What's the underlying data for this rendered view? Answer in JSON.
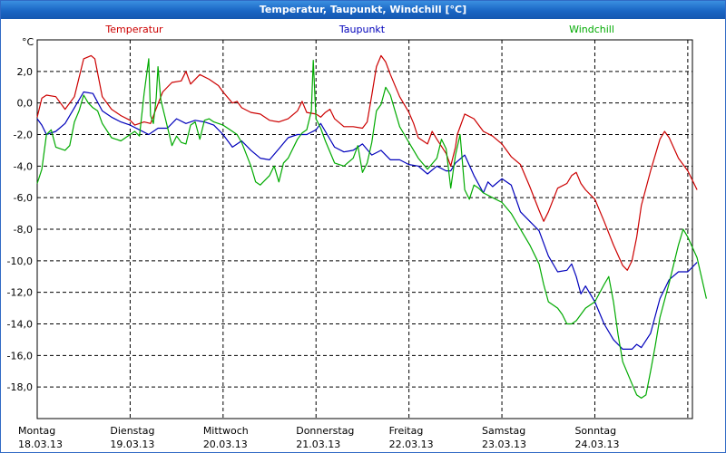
{
  "window": {
    "title": "Temperatur, Taupunkt, Windchill [°C]"
  },
  "chart_data": {
    "type": "line",
    "title": "Temperatur, Taupunkt, Windchill [°C]",
    "ylabel": "°C",
    "ylim": [
      -20,
      4
    ],
    "xlim": [
      0,
      7
    ],
    "yticks": [
      2,
      0,
      -2,
      -4,
      -6,
      -8,
      -10,
      -12,
      -14,
      -16,
      -18
    ],
    "ytick_labels": [
      "2,0",
      "0,0",
      "-2,0",
      "-4,0",
      "-6,0",
      "-8,0",
      "-10,0",
      "-12,0",
      "-14,0",
      "-16,0",
      "-18,0"
    ],
    "x_tick_labels": [
      {
        "day": "Montag",
        "date": "18.03.13"
      },
      {
        "day": "Dienstag",
        "date": "19.03.13"
      },
      {
        "day": "Mittwoch",
        "date": "20.03.13"
      },
      {
        "day": "Donnerstag",
        "date": "21.03.13"
      },
      {
        "day": "Freitag",
        "date": "22.03.13"
      },
      {
        "day": "Samstag",
        "date": "23.03.13"
      },
      {
        "day": "Sonntag",
        "date": "24.03.13"
      }
    ],
    "grid": true,
    "legend_position": "top",
    "series": [
      {
        "name": "Temperatur",
        "color": "#cc0000",
        "points": [
          [
            0,
            -0.9
          ],
          [
            0.05,
            0.3
          ],
          [
            0.1,
            0.5
          ],
          [
            0.2,
            0.4
          ],
          [
            0.3,
            -0.4
          ],
          [
            0.4,
            0.4
          ],
          [
            0.5,
            2.8
          ],
          [
            0.58,
            3.0
          ],
          [
            0.62,
            2.8
          ],
          [
            0.7,
            0.4
          ],
          [
            0.8,
            -0.4
          ],
          [
            0.9,
            -0.8
          ],
          [
            1.0,
            -1.1
          ],
          [
            1.05,
            -1.4
          ],
          [
            1.15,
            -1.2
          ],
          [
            1.22,
            -1.3
          ],
          [
            1.27,
            -0.5
          ],
          [
            1.35,
            0.7
          ],
          [
            1.45,
            1.3
          ],
          [
            1.55,
            1.4
          ],
          [
            1.6,
            2.0
          ],
          [
            1.65,
            1.2
          ],
          [
            1.75,
            1.8
          ],
          [
            1.85,
            1.5
          ],
          [
            1.95,
            1.1
          ],
          [
            2.0,
            0.7
          ],
          [
            2.1,
            0.0
          ],
          [
            2.15,
            0.1
          ],
          [
            2.2,
            -0.3
          ],
          [
            2.3,
            -0.6
          ],
          [
            2.4,
            -0.7
          ],
          [
            2.5,
            -1.1
          ],
          [
            2.6,
            -1.2
          ],
          [
            2.7,
            -1.0
          ],
          [
            2.8,
            -0.5
          ],
          [
            2.85,
            0.1
          ],
          [
            2.9,
            -0.6
          ],
          [
            3.0,
            -0.7
          ],
          [
            3.05,
            -0.9
          ],
          [
            3.1,
            -0.6
          ],
          [
            3.15,
            -0.4
          ],
          [
            3.2,
            -1.0
          ],
          [
            3.3,
            -1.5
          ],
          [
            3.4,
            -1.5
          ],
          [
            3.5,
            -1.6
          ],
          [
            3.55,
            -1.2
          ],
          [
            3.6,
            0.5
          ],
          [
            3.65,
            2.3
          ],
          [
            3.7,
            3.0
          ],
          [
            3.75,
            2.6
          ],
          [
            3.8,
            1.8
          ],
          [
            3.9,
            0.4
          ],
          [
            4.0,
            -0.6
          ],
          [
            4.05,
            -1.3
          ],
          [
            4.1,
            -2.2
          ],
          [
            4.2,
            -2.6
          ],
          [
            4.25,
            -1.8
          ],
          [
            4.3,
            -2.3
          ],
          [
            4.4,
            -3.2
          ],
          [
            4.45,
            -4.0
          ],
          [
            4.5,
            -2.8
          ],
          [
            4.52,
            -2.0
          ],
          [
            4.6,
            -0.7
          ],
          [
            4.7,
            -1.0
          ],
          [
            4.8,
            -1.8
          ],
          [
            4.9,
            -2.1
          ],
          [
            5.0,
            -2.6
          ],
          [
            5.1,
            -3.4
          ],
          [
            5.2,
            -3.9
          ],
          [
            5.3,
            -5.3
          ],
          [
            5.4,
            -6.8
          ],
          [
            5.45,
            -7.5
          ],
          [
            5.5,
            -6.9
          ],
          [
            5.6,
            -5.4
          ],
          [
            5.7,
            -5.1
          ],
          [
            5.75,
            -4.6
          ],
          [
            5.8,
            -4.4
          ],
          [
            5.85,
            -5.1
          ],
          [
            5.9,
            -5.5
          ],
          [
            6.0,
            -6.1
          ],
          [
            6.1,
            -7.5
          ],
          [
            6.2,
            -9.0
          ],
          [
            6.3,
            -10.3
          ],
          [
            6.35,
            -10.6
          ],
          [
            6.4,
            -10.0
          ],
          [
            6.45,
            -8.5
          ],
          [
            6.5,
            -6.5
          ],
          [
            6.6,
            -4.3
          ],
          [
            6.7,
            -2.3
          ],
          [
            6.75,
            -1.8
          ],
          [
            6.8,
            -2.2
          ],
          [
            6.9,
            -3.5
          ],
          [
            7.0,
            -4.3
          ],
          [
            7.1,
            -5.5
          ]
        ]
      },
      {
        "name": "Taupunkt",
        "color": "#0000bb",
        "points": [
          [
            0,
            -1.0
          ],
          [
            0.05,
            -1.4
          ],
          [
            0.1,
            -2.0
          ],
          [
            0.2,
            -1.8
          ],
          [
            0.3,
            -1.3
          ],
          [
            0.4,
            -0.3
          ],
          [
            0.5,
            0.7
          ],
          [
            0.6,
            0.6
          ],
          [
            0.7,
            -0.5
          ],
          [
            0.8,
            -0.9
          ],
          [
            0.9,
            -1.2
          ],
          [
            1.0,
            -1.4
          ],
          [
            1.1,
            -1.7
          ],
          [
            1.2,
            -2.0
          ],
          [
            1.3,
            -1.6
          ],
          [
            1.4,
            -1.6
          ],
          [
            1.5,
            -1.0
          ],
          [
            1.6,
            -1.3
          ],
          [
            1.7,
            -1.1
          ],
          [
            1.8,
            -1.2
          ],
          [
            1.9,
            -1.4
          ],
          [
            2.0,
            -2.0
          ],
          [
            2.1,
            -2.8
          ],
          [
            2.2,
            -2.4
          ],
          [
            2.3,
            -3.0
          ],
          [
            2.4,
            -3.5
          ],
          [
            2.5,
            -3.6
          ],
          [
            2.6,
            -2.9
          ],
          [
            2.7,
            -2.2
          ],
          [
            2.8,
            -2.0
          ],
          [
            2.9,
            -2.0
          ],
          [
            3.0,
            -1.7
          ],
          [
            3.05,
            -1.3
          ],
          [
            3.1,
            -1.8
          ],
          [
            3.2,
            -2.8
          ],
          [
            3.3,
            -3.1
          ],
          [
            3.4,
            -3.0
          ],
          [
            3.5,
            -2.6
          ],
          [
            3.6,
            -3.3
          ],
          [
            3.7,
            -3.0
          ],
          [
            3.8,
            -3.6
          ],
          [
            3.9,
            -3.6
          ],
          [
            4.0,
            -3.9
          ],
          [
            4.1,
            -4.0
          ],
          [
            4.2,
            -4.5
          ],
          [
            4.3,
            -4.0
          ],
          [
            4.4,
            -4.3
          ],
          [
            4.45,
            -4.3
          ],
          [
            4.5,
            -3.8
          ],
          [
            4.6,
            -3.3
          ],
          [
            4.7,
            -4.6
          ],
          [
            4.8,
            -5.7
          ],
          [
            4.85,
            -5.0
          ],
          [
            4.9,
            -5.3
          ],
          [
            5.0,
            -4.8
          ],
          [
            5.1,
            -5.2
          ],
          [
            5.2,
            -6.9
          ],
          [
            5.3,
            -7.5
          ],
          [
            5.4,
            -8.1
          ],
          [
            5.5,
            -9.7
          ],
          [
            5.6,
            -10.7
          ],
          [
            5.7,
            -10.6
          ],
          [
            5.75,
            -10.2
          ],
          [
            5.8,
            -11.0
          ],
          [
            5.85,
            -12.1
          ],
          [
            5.9,
            -11.6
          ],
          [
            6.0,
            -12.6
          ],
          [
            6.1,
            -14.0
          ],
          [
            6.2,
            -15.0
          ],
          [
            6.3,
            -15.6
          ],
          [
            6.4,
            -15.6
          ],
          [
            6.45,
            -15.3
          ],
          [
            6.5,
            -15.5
          ],
          [
            6.6,
            -14.6
          ],
          [
            6.7,
            -12.4
          ],
          [
            6.8,
            -11.2
          ],
          [
            6.9,
            -10.7
          ],
          [
            7.0,
            -10.7
          ],
          [
            7.1,
            -10.1
          ]
        ]
      },
      {
        "name": "Windchill",
        "color": "#00aa00",
        "points": [
          [
            0,
            -5.1
          ],
          [
            0.05,
            -4.2
          ],
          [
            0.1,
            -2.0
          ],
          [
            0.15,
            -1.7
          ],
          [
            0.2,
            -2.8
          ],
          [
            0.3,
            -3.0
          ],
          [
            0.35,
            -2.7
          ],
          [
            0.4,
            -1.2
          ],
          [
            0.45,
            -0.5
          ],
          [
            0.5,
            0.5
          ],
          [
            0.55,
            0.0
          ],
          [
            0.6,
            -0.3
          ],
          [
            0.65,
            -0.5
          ],
          [
            0.7,
            -1.3
          ],
          [
            0.8,
            -2.2
          ],
          [
            0.9,
            -2.4
          ],
          [
            1.0,
            -2.0
          ],
          [
            1.05,
            -1.8
          ],
          [
            1.1,
            -2.1
          ],
          [
            1.15,
            0.6
          ],
          [
            1.2,
            2.8
          ],
          [
            1.22,
            -0.8
          ],
          [
            1.25,
            -1.3
          ],
          [
            1.28,
            0.3
          ],
          [
            1.3,
            2.3
          ],
          [
            1.33,
            0.2
          ],
          [
            1.4,
            -1.5
          ],
          [
            1.45,
            -2.7
          ],
          [
            1.5,
            -2.1
          ],
          [
            1.55,
            -2.5
          ],
          [
            1.6,
            -2.6
          ],
          [
            1.65,
            -1.4
          ],
          [
            1.7,
            -1.2
          ],
          [
            1.75,
            -2.3
          ],
          [
            1.8,
            -1.1
          ],
          [
            1.85,
            -1.0
          ],
          [
            1.9,
            -1.2
          ],
          [
            2.0,
            -1.4
          ],
          [
            2.1,
            -1.8
          ],
          [
            2.15,
            -2.0
          ],
          [
            2.2,
            -2.5
          ],
          [
            2.3,
            -4.0
          ],
          [
            2.35,
            -5.0
          ],
          [
            2.4,
            -5.2
          ],
          [
            2.5,
            -4.6
          ],
          [
            2.55,
            -4.0
          ],
          [
            2.6,
            -5.0
          ],
          [
            2.65,
            -3.8
          ],
          [
            2.7,
            -3.5
          ],
          [
            2.8,
            -2.3
          ],
          [
            2.85,
            -1.9
          ],
          [
            2.9,
            -1.7
          ],
          [
            2.95,
            -0.5
          ],
          [
            2.97,
            2.7
          ],
          [
            3.0,
            -1.0
          ],
          [
            3.05,
            -1.6
          ],
          [
            3.1,
            -2.4
          ],
          [
            3.2,
            -3.8
          ],
          [
            3.3,
            -4.0
          ],
          [
            3.4,
            -3.5
          ],
          [
            3.45,
            -2.7
          ],
          [
            3.5,
            -4.4
          ],
          [
            3.55,
            -3.8
          ],
          [
            3.6,
            -2.5
          ],
          [
            3.65,
            -0.5
          ],
          [
            3.7,
            -0.1
          ],
          [
            3.75,
            1.0
          ],
          [
            3.8,
            0.5
          ],
          [
            3.85,
            -0.5
          ],
          [
            3.9,
            -1.5
          ],
          [
            3.95,
            -2.0
          ],
          [
            4.0,
            -2.5
          ],
          [
            4.05,
            -3.0
          ],
          [
            4.1,
            -3.5
          ],
          [
            4.2,
            -4.2
          ],
          [
            4.3,
            -3.5
          ],
          [
            4.35,
            -2.3
          ],
          [
            4.4,
            -2.9
          ],
          [
            4.45,
            -5.4
          ],
          [
            4.5,
            -3.3
          ],
          [
            4.55,
            -2.0
          ],
          [
            4.6,
            -5.5
          ],
          [
            4.65,
            -6.1
          ],
          [
            4.7,
            -5.2
          ],
          [
            4.75,
            -5.4
          ],
          [
            4.8,
            -5.7
          ],
          [
            4.9,
            -6.0
          ],
          [
            5.0,
            -6.3
          ],
          [
            5.1,
            -7.0
          ],
          [
            5.2,
            -8.0
          ],
          [
            5.3,
            -9.0
          ],
          [
            5.4,
            -10.2
          ],
          [
            5.45,
            -11.5
          ],
          [
            5.5,
            -12.6
          ],
          [
            5.6,
            -13.0
          ],
          [
            5.65,
            -13.4
          ],
          [
            5.7,
            -14.0
          ],
          [
            5.75,
            -14.0
          ],
          [
            5.8,
            -13.8
          ],
          [
            5.9,
            -13.0
          ],
          [
            6.0,
            -12.6
          ],
          [
            6.1,
            -11.5
          ],
          [
            6.15,
            -11.0
          ],
          [
            6.2,
            -12.6
          ],
          [
            6.25,
            -14.7
          ],
          [
            6.3,
            -16.4
          ],
          [
            6.4,
            -17.8
          ],
          [
            6.45,
            -18.5
          ],
          [
            6.5,
            -18.7
          ],
          [
            6.55,
            -18.5
          ],
          [
            6.6,
            -17.0
          ],
          [
            6.65,
            -15.4
          ],
          [
            6.7,
            -13.6
          ],
          [
            6.8,
            -11.4
          ],
          [
            6.9,
            -9.0
          ],
          [
            6.95,
            -8.0
          ],
          [
            7.0,
            -8.5
          ],
          [
            7.1,
            -9.8
          ],
          [
            7.2,
            -12.4
          ]
        ]
      }
    ]
  }
}
